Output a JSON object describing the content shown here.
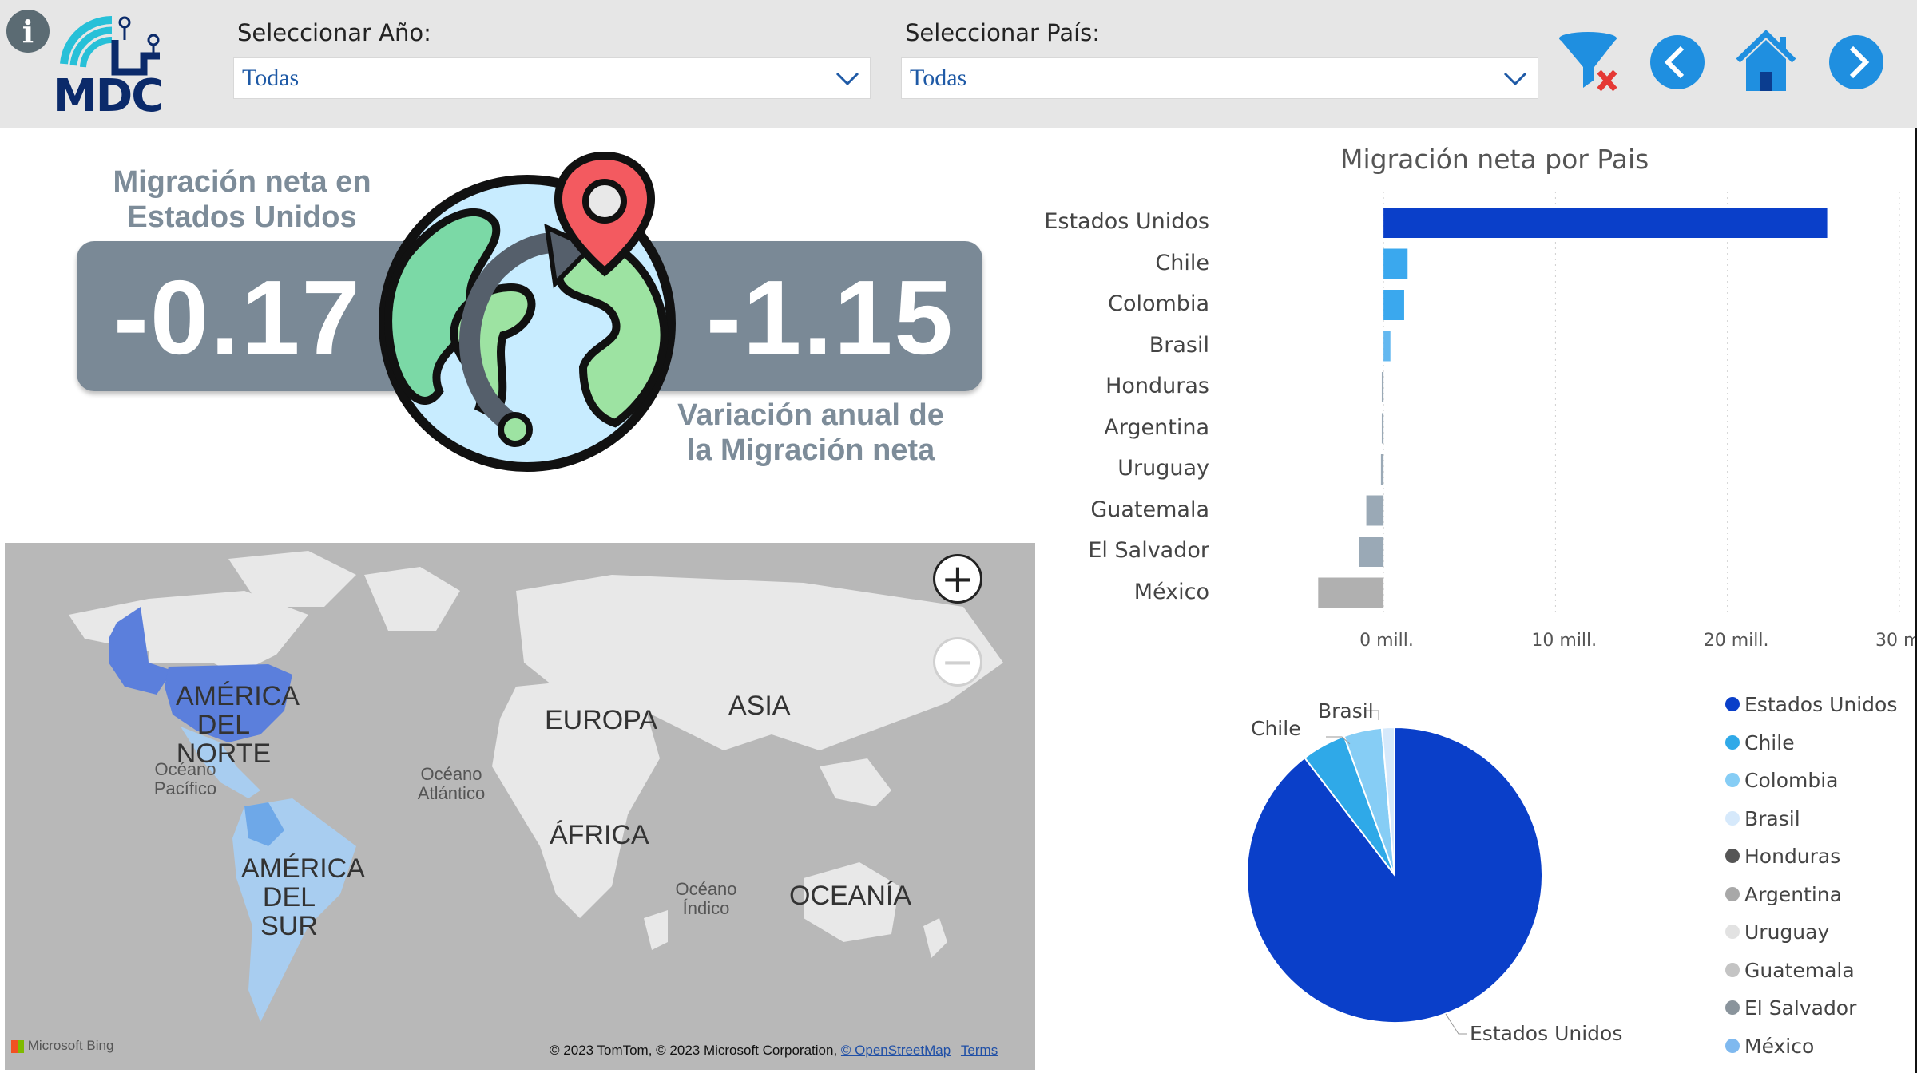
{
  "header": {
    "info_icon": "info-icon",
    "logo_text": "MDC",
    "year_label": "Seleccionar Año:",
    "year_value": "Todas",
    "country_label": "Seleccionar País:",
    "country_value": "Todas",
    "icons": [
      "clear-filter-icon",
      "back-icon",
      "home-icon",
      "forward-icon"
    ]
  },
  "kpi": {
    "title_line1": "Migración neta en",
    "title_line2": "Estados Unidos",
    "value": "-0.17",
    "variation": "-1.15",
    "variation_line1": "Variación anual de",
    "variation_line2": "la Migración neta"
  },
  "map": {
    "labels": {
      "north_america_1": "AMÉRICA",
      "north_america_2": "DEL",
      "north_america_3": "NORTE",
      "europe": "EUROPA",
      "asia": "ASIA",
      "africa": "ÁFRICA",
      "south_america_1": "AMÉRICA",
      "south_america_2": "DEL",
      "south_america_3": "SUR",
      "oceania": "OCEANÍA"
    },
    "oceans": {
      "pacific_1": "Océano",
      "pacific_2": "Pacífico",
      "atlantic_1": "Océano",
      "atlantic_2": "Atlántico",
      "indian_1": "Océano",
      "indian_2": "Índico"
    },
    "credit": "© 2023 TomTom, © 2023 Microsoft Corporation,",
    "osm": "© OpenStreetMap",
    "terms": "Terms",
    "bing": "Microsoft Bing"
  },
  "chart_data": [
    {
      "type": "bar",
      "title": "Migración neta por Pais",
      "categories": [
        "Estados Unidos",
        "Chile",
        "Colombia",
        "Brasil",
        "Honduras",
        "Argentina",
        "Uruguay",
        "Guatemala",
        "El Salvador",
        "México"
      ],
      "values": [
        25.8,
        1.4,
        1.2,
        0.4,
        -0.1,
        -0.1,
        -0.15,
        -1.0,
        -1.4,
        -3.8
      ],
      "unit": "mill.",
      "xlim": [
        -4,
        30
      ],
      "ticks": [
        "0 mill.",
        "10 mill.",
        "20 mill.",
        "30 mill."
      ],
      "tick_values": [
        0,
        10,
        20,
        30
      ],
      "colors": [
        "#0a3fc9",
        "#3aa8ee",
        "#3aa8ee",
        "#63b8f0",
        "#9aa9b6",
        "#9aa9b6",
        "#9aa9b6",
        "#9aa9b6",
        "#9aa9b6",
        "#b0b0b0"
      ],
      "grid": true
    },
    {
      "type": "pie",
      "categories": [
        "Estados Unidos",
        "Chile",
        "Colombia",
        "Brasil",
        "Honduras",
        "Argentina",
        "Uruguay",
        "Guatemala",
        "El Salvador",
        "México"
      ],
      "values": [
        25.8,
        1.4,
        1.2,
        0.4,
        0,
        0,
        0,
        0,
        0,
        0
      ],
      "colors": [
        "#0a3fc9",
        "#2fa9e8",
        "#86cdf5",
        "#d6e9fb",
        "#555555",
        "#a8a8a8",
        "#e2e2e2",
        "#c4c4c4",
        "#8a949c",
        "#7fb9ef"
      ],
      "slice_labels": [
        "Estados Unidos",
        "Chile",
        "Brasil"
      ],
      "legend": "right"
    }
  ]
}
